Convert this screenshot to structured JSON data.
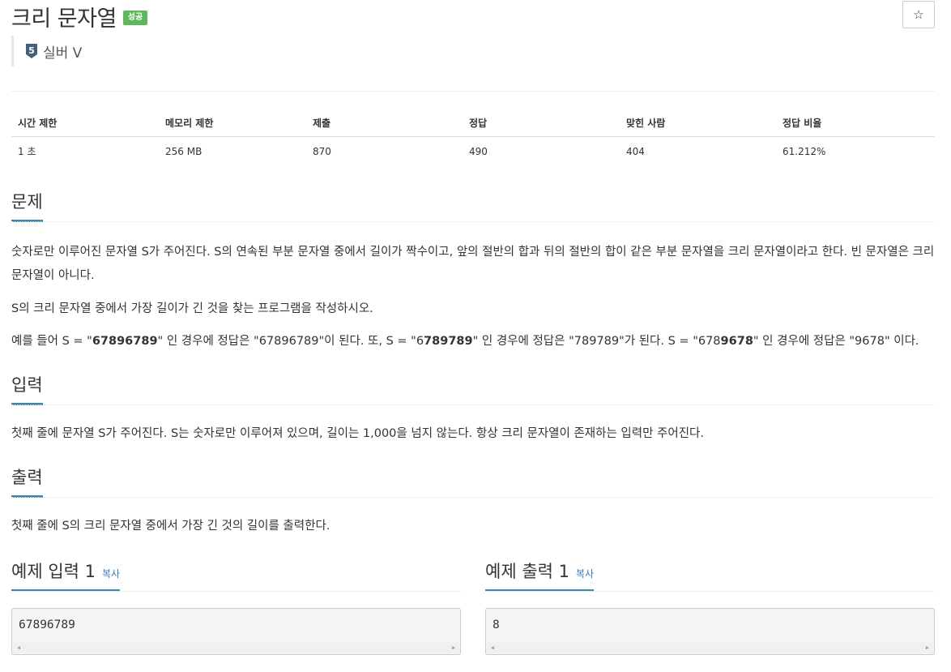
{
  "problem": {
    "title": "크리 문자열",
    "status_badge": "성공",
    "tier_number": "5",
    "tier_label": "실버 V",
    "star_icon": "☆"
  },
  "info_table": {
    "headers": [
      "시간 제한",
      "메모리 제한",
      "제출",
      "정답",
      "맞힌 사람",
      "정답 비율"
    ],
    "values": [
      "1 초",
      "256 MB",
      "870",
      "490",
      "404",
      "61.212%"
    ]
  },
  "sections": {
    "problem_heading": "문제",
    "problem_p1": "숫자로만 이루어진 문자열 S가 주어진다. S의 연속된 부분 문자열 중에서 길이가 짝수이고, 앞의 절반의 합과 뒤의 절반의 합이 같은 부분 문자열을 크리 문자열이라고 한다. 빈 문자열은 크리 문자열이 아니다.",
    "problem_p2": "S의 크리 문자열 중에서 가장 길이가 긴 것을 찾는 프로그램을 작성하시오.",
    "example": {
      "t1": "예를 들어 S = \"",
      "b1": "67896789",
      "t2": "\" 인 경우에 정답은 \"67896789\"이 된다. 또, S = \"6",
      "b2": "789789",
      "t3": "\" 인 경우에 정답은 \"789789\"가 된다. S = \"678",
      "b3": "9678",
      "t4": "\" 인 경우에 정답은 \"9678\" 이다."
    },
    "input_heading": "입력",
    "input_text": "첫째 줄에 문자열 S가 주어진다. S는 숫자로만 이루어져 있으며, 길이는 1,000을 넘지 않는다. 항상 크리 문자열이 존재하는 입력만 주어진다.",
    "output_heading": "출력",
    "output_text": "첫째 줄에 S의 크리 문자열 중에서 가장 긴 것의 길이를 출력한다."
  },
  "samples": {
    "input_heading": "예제 입력 1",
    "output_heading": "예제 출력 1",
    "copy_label": "복사",
    "input_value": "67896789",
    "output_value": "8"
  },
  "colors": {
    "success_badge": "#5cb85c",
    "section_underline": "#3a87ad",
    "link": "#337ab7"
  }
}
